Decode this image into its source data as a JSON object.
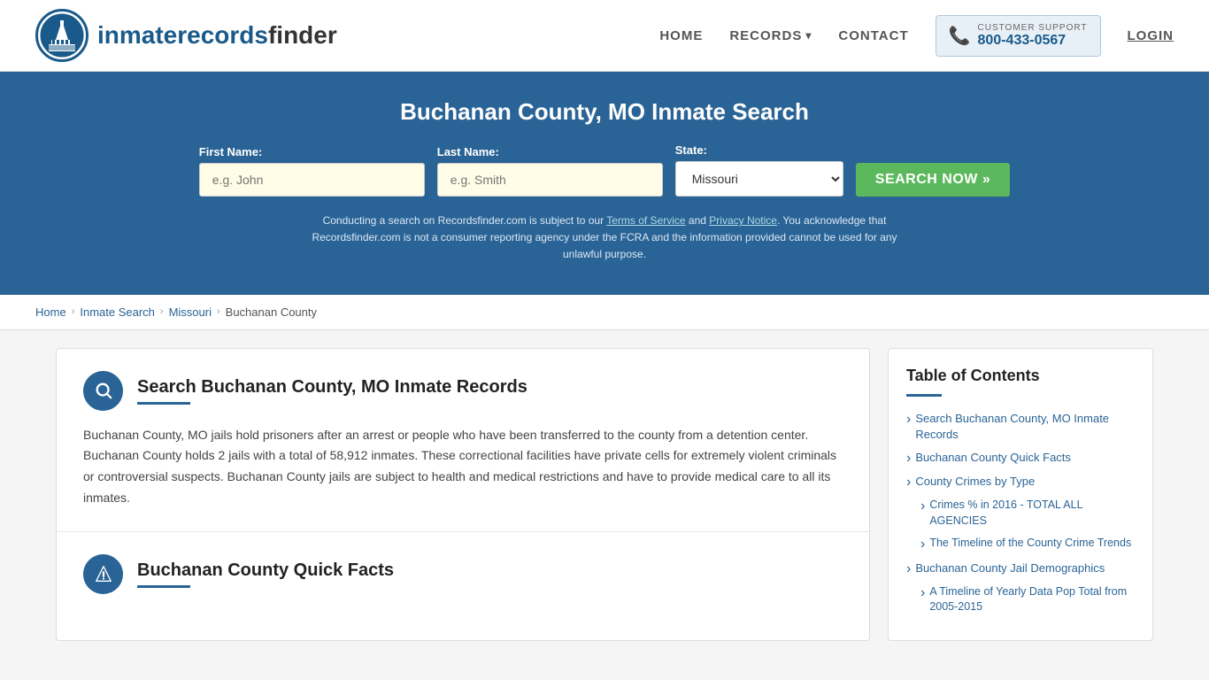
{
  "header": {
    "logo_text_main": "inmaterecords",
    "logo_text_bold": "finder",
    "nav": {
      "home": "HOME",
      "records": "RECORDS",
      "contact": "CONTACT",
      "login": "LOGIN"
    },
    "customer_support": {
      "label": "CUSTOMER SUPPORT",
      "number": "800-433-0567"
    }
  },
  "hero": {
    "title": "Buchanan County, MO Inmate Search",
    "form": {
      "first_name_label": "First Name:",
      "first_name_placeholder": "e.g. John",
      "last_name_label": "Last Name:",
      "last_name_placeholder": "e.g. Smith",
      "state_label": "State:",
      "state_value": "Missouri",
      "search_button": "SEARCH NOW »"
    },
    "disclaimer": "Conducting a search on Recordsfinder.com is subject to our Terms of Service and Privacy Notice. You acknowledge that Recordsfinder.com is not a consumer reporting agency under the FCRA and the information provided cannot be used for any unlawful purpose."
  },
  "breadcrumb": {
    "items": [
      "Home",
      "Inmate Search",
      "Missouri",
      "Buchanan County"
    ]
  },
  "main": {
    "section1": {
      "title": "Search Buchanan County, MO Inmate Records",
      "body": "Buchanan County, MO jails hold prisoners after an arrest or people who have been transferred to the county from a detention center. Buchanan County holds 2 jails with a total of 58,912 inmates. These correctional facilities have private cells for extremely violent criminals or controversial suspects. Buchanan County jails are subject to health and medical restrictions and have to provide medical care to all its inmates."
    },
    "section2": {
      "title": "Buchanan County Quick Facts"
    }
  },
  "toc": {
    "title": "Table of Contents",
    "items": [
      {
        "label": "Search Buchanan County, MO Inmate Records",
        "sub": false
      },
      {
        "label": "Buchanan County Quick Facts",
        "sub": false
      },
      {
        "label": "County Crimes by Type",
        "sub": false
      },
      {
        "label": "Crimes % in 2016 - TOTAL ALL AGENCIES",
        "sub": true
      },
      {
        "label": "The Timeline of the County Crime Trends",
        "sub": true
      },
      {
        "label": "Buchanan County Jail Demographics",
        "sub": false
      },
      {
        "label": "A Timeline of Yearly Data Pop Total from 2005-2015",
        "sub": true
      }
    ]
  }
}
